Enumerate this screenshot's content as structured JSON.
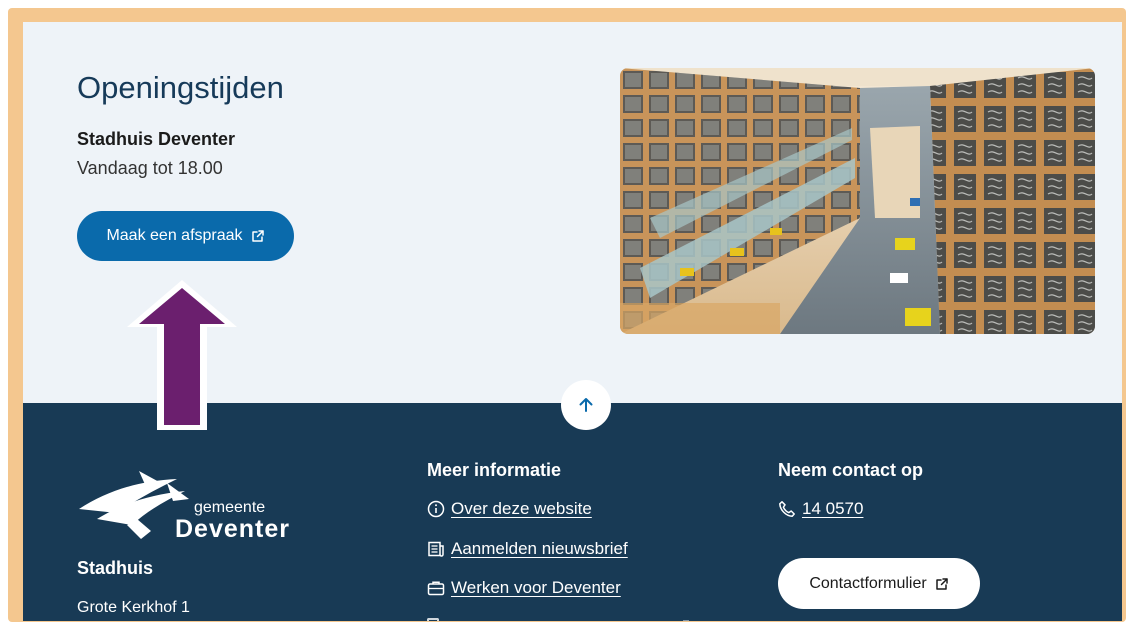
{
  "hours": {
    "title": "Openingstijden",
    "location": "Stadhuis Deventer",
    "today": "Vandaag tot 18.00",
    "appointment_button": "Maak een afspraak"
  },
  "footer": {
    "logo": {
      "line1": "gemeente",
      "line2": "Deventer"
    },
    "address": {
      "title": "Stadhuis",
      "street": "Grote Kerkhof 1"
    },
    "more_info": {
      "title": "Meer informatie",
      "links": [
        {
          "label": "Over deze website",
          "icon": "info-circle-icon"
        },
        {
          "label": "Aanmelden nieuwsbrief",
          "icon": "newspaper-icon"
        },
        {
          "label": "Werken voor Deventer",
          "icon": "briefcase-icon"
        }
      ]
    },
    "contact": {
      "title": "Neem contact op",
      "phone": "14 0570",
      "form_button": "Contactformulier"
    }
  },
  "colors": {
    "frame": "#f4c78f",
    "page_bg": "#eef3f8",
    "footer_bg": "#183a55",
    "primary": "#0a6aab",
    "heading": "#163a59",
    "annotation_arrow": "#6b1f6e"
  }
}
